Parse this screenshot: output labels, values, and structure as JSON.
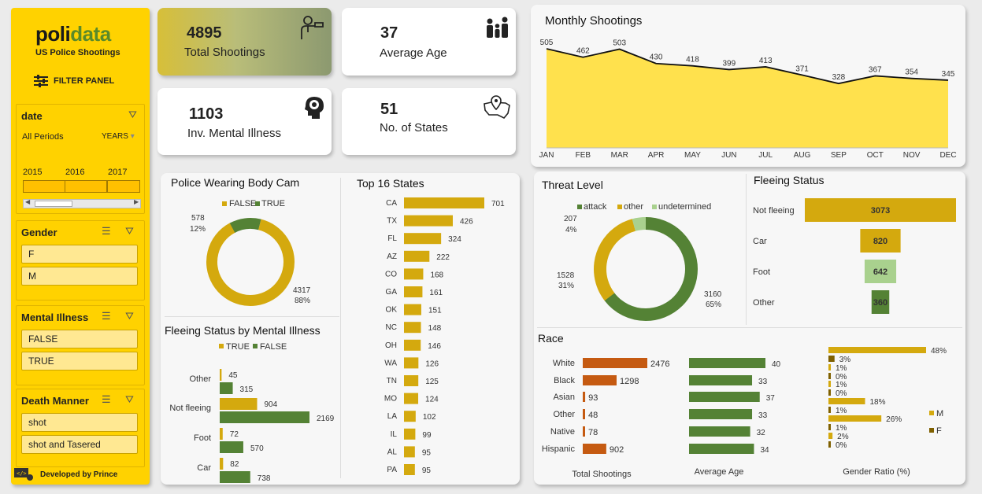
{
  "sidebar": {
    "logo_a": "poli",
    "logo_b": "data",
    "subtitle": "US Police Shootings",
    "filter_panel": "FILTER PANEL",
    "date_slicer": {
      "title": "date",
      "period": "All Periods",
      "unit": "YEARS",
      "years": [
        "2015",
        "2016",
        "2017"
      ]
    },
    "gender": {
      "title": "Gender",
      "options": [
        "F",
        "M"
      ]
    },
    "mental": {
      "title": "Mental Illness",
      "options": [
        "FALSE",
        "TRUE"
      ]
    },
    "death": {
      "title": "Death Manner",
      "options": [
        "shot",
        "shot and Tasered"
      ]
    },
    "developer": "Developed by Prince"
  },
  "kpis": {
    "total": {
      "value": "4895",
      "label": "Total Shootings",
      "icon": "gunman-icon"
    },
    "age": {
      "value": "37",
      "label": "Average Age",
      "icon": "family-icon"
    },
    "mental": {
      "value": "1103",
      "label": "Inv. Mental Illness",
      "icon": "brain-icon"
    },
    "states": {
      "value": "51",
      "label": "No. of States",
      "icon": "map-pin-icon"
    }
  },
  "colors": {
    "gold": "#d4a90e",
    "green": "#548235",
    "orange": "#c55a11",
    "lightgreen": "#a9d18e",
    "yellow": "#ffe14d",
    "brown": "#7f6000"
  },
  "chart_data": [
    {
      "id": "monthly",
      "type": "area",
      "title": "Monthly Shootings",
      "categories": [
        "JAN",
        "FEB",
        "MAR",
        "APR",
        "MAY",
        "JUN",
        "JUL",
        "AUG",
        "SEP",
        "OCT",
        "NOV",
        "DEC"
      ],
      "values": [
        505,
        462,
        503,
        430,
        418,
        399,
        413,
        371,
        328,
        367,
        354,
        345
      ]
    },
    {
      "id": "bodycam",
      "type": "pie",
      "title": "Police Wearing Body Cam",
      "labels": [
        "FALSE",
        "TRUE"
      ],
      "values": [
        4317,
        578
      ],
      "percents": [
        "88%",
        "12%"
      ]
    },
    {
      "id": "states",
      "type": "bar",
      "title": "Top 16 States",
      "categories": [
        "CA",
        "TX",
        "FL",
        "AZ",
        "CO",
        "GA",
        "OK",
        "NC",
        "OH",
        "WA",
        "TN",
        "MO",
        "LA",
        "IL",
        "AL",
        "PA"
      ],
      "values": [
        701,
        426,
        324,
        222,
        168,
        161,
        151,
        148,
        146,
        126,
        125,
        124,
        102,
        99,
        95,
        95
      ]
    },
    {
      "id": "fleemental",
      "type": "bar",
      "title": "Fleeing Status by Mental Illness",
      "categories": [
        "Other",
        "Not fleeing",
        "Foot",
        "Car"
      ],
      "series": [
        {
          "name": "TRUE",
          "values": [
            45,
            904,
            72,
            82
          ]
        },
        {
          "name": "FALSE",
          "values": [
            315,
            2169,
            570,
            738
          ]
        }
      ]
    },
    {
      "id": "threat",
      "type": "pie",
      "title": "Threat Level",
      "labels": [
        "attack",
        "other",
        "undetermined"
      ],
      "values": [
        3160,
        1528,
        207
      ],
      "percents": [
        "65%",
        "31%",
        "4%"
      ]
    },
    {
      "id": "fleeing",
      "type": "bar",
      "title": "Fleeing Status",
      "categories": [
        "Not fleeing",
        "Car",
        "Foot",
        "Other"
      ],
      "values": [
        3073,
        820,
        642,
        360
      ]
    },
    {
      "id": "race",
      "type": "bar",
      "title": "Race",
      "categories": [
        "White",
        "Black",
        "Asian",
        "Other",
        "Native",
        "Hispanic"
      ],
      "total_shootings": [
        2476,
        1298,
        93,
        48,
        78,
        902
      ],
      "average_age": [
        40,
        33,
        37,
        33,
        32,
        34
      ],
      "gender_m": [
        48,
        1,
        1,
        18,
        26,
        2
      ],
      "gender_f": [
        3,
        0,
        0,
        1,
        1,
        0
      ],
      "xlabels": [
        "Total Shootings",
        "Average Age",
        "Gender Ratio (%)"
      ],
      "legend": [
        "M",
        "F"
      ]
    }
  ]
}
